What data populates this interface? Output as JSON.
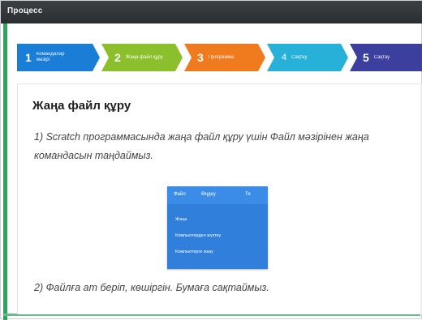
{
  "window": {
    "title": "Процесс"
  },
  "steps": [
    {
      "number": "1",
      "label": "Командалар мәзірі",
      "color": "#1b7ed6"
    },
    {
      "number": "2",
      "label": "Жаңа файл құру",
      "color": "#8cbf2c"
    },
    {
      "number": "3",
      "label": "Программа",
      "color": "#f07a1e"
    },
    {
      "number": "4",
      "label": "Сақтау",
      "color": "#27b1d8"
    },
    {
      "number": "5",
      "label": "Сақтау",
      "color": "#3c3f9e"
    }
  ],
  "content": {
    "heading": "Жаңа файл құру",
    "step1_text": "1)  Scratch программасында жаңа файл құру үшін Файл мәзірінен жаңа командасын таңдаймыз.",
    "step2_text": "2)  Файлға ат беріп, көшіргін. Бумаға сақтаймыз."
  },
  "menu_screenshot": {
    "top_items": [
      "Файл",
      "Өңдеу",
      "Те"
    ],
    "items": [
      "Жаңа",
      "Компьютерден жүктеу",
      "Компьютерге жазу"
    ],
    "bg_color": "#2f7fdb"
  }
}
